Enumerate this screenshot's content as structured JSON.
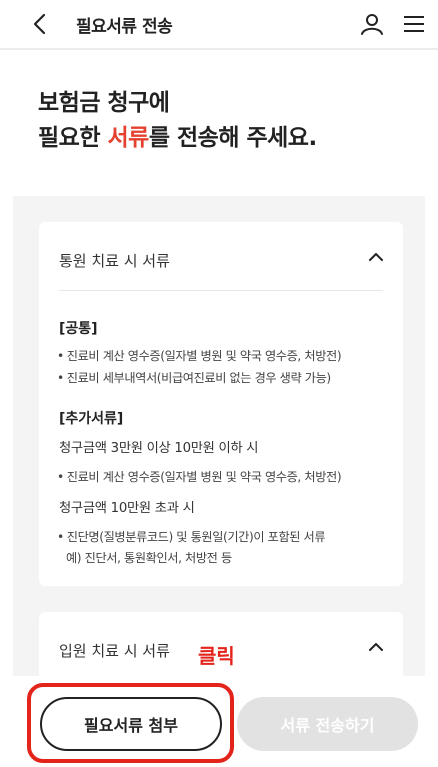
{
  "header": {
    "title": "필요서류 전송",
    "back_icon": "chevron-left-icon",
    "user_icon": "user-icon",
    "menu_icon": "hamburger-menu-icon"
  },
  "headline": {
    "line1": "보험금 청구에",
    "line2_prefix": "필요한 ",
    "line2_accent": "서류",
    "line2_suffix": "를 전송해 주세요.",
    "accent_color": "#e5412f"
  },
  "outpatient": {
    "title": "통원 치료 시 서류",
    "expanded": true,
    "common": {
      "heading": "[공통]",
      "items": [
        "진료비 계산 영수증(일자별 병원 및 약국 영수증, 처방전)",
        "진료비 세부내역서(비급여진료비 없는 경우 생략 가능)"
      ]
    },
    "additional": {
      "heading": "[추가서류]",
      "groups": [
        {
          "condition": "청구금액 3만원 이상 10만원 이하 시",
          "items": [
            "진료비 계산 영수증(일자별 병원 및 약국 영수증, 처방전)"
          ]
        },
        {
          "condition": "청구금액 10만원 초과 시",
          "item_line1": "진단명(질병분류코드) 및 통원일(기간)이 포함된 서류",
          "item_line2": "예) 진단서, 통원확인서, 처방전 등"
        }
      ]
    }
  },
  "inpatient": {
    "title": "입원 치료 시 서류",
    "expanded": false
  },
  "annotation": {
    "click_label": "클릭",
    "color": "#e3241b"
  },
  "buttons": {
    "attach": "필요서류 첨부",
    "send": "서류 전송하기"
  }
}
